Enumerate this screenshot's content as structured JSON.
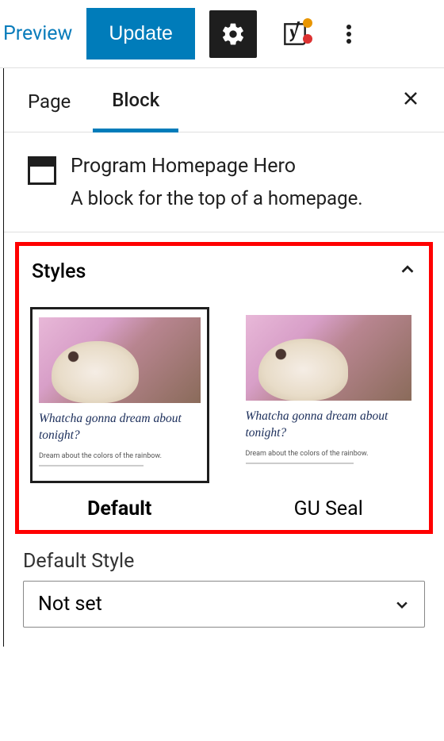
{
  "toolbar": {
    "preview": "Preview",
    "update": "Update"
  },
  "tabs": {
    "page": "Page",
    "block": "Block"
  },
  "block": {
    "title": "Program Homepage Hero",
    "description": "A block for the top of a homepage."
  },
  "styles": {
    "heading": "Styles",
    "caption_title": "Whatcha gonna dream about tonight?",
    "caption_sub": "Dream about the colors of the rainbow.",
    "options": [
      {
        "label": "Default",
        "selected": true
      },
      {
        "label": "GU Seal",
        "selected": false
      }
    ]
  },
  "default_style": {
    "label": "Default Style",
    "value": "Not set"
  }
}
